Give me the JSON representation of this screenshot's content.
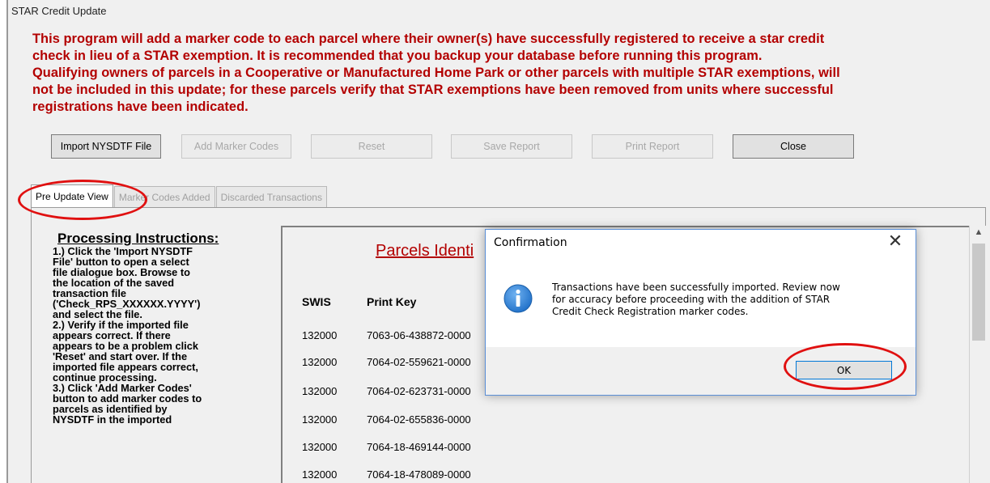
{
  "window": {
    "title": "STAR Credit Update"
  },
  "intro_lines": [
    "This program will add a marker code to each parcel where their owner(s) have successfully registered to receive a star credit",
    "check in lieu of a STAR exemption.  It is recommended that you backup your database before running this program.",
    "Qualifying owners of parcels in a Cooperative or Manufactured Home Park or other parcels with multiple STAR exemptions, will",
    "not be included in this update; for these parcels verify that STAR exemptions have been removed from units where successful",
    "registrations have been indicated."
  ],
  "toolbar": {
    "import_label": "Import NYSDTF File",
    "add_marker_label": "Add Marker Codes",
    "reset_label": "Reset",
    "save_report_label": "Save Report",
    "print_report_label": "Print Report",
    "close_label": "Close"
  },
  "tabs": [
    {
      "label": "Pre Update View",
      "active": true
    },
    {
      "label": "Marker Codes Added",
      "active": false
    },
    {
      "label": "Discarded Transactions",
      "active": false
    }
  ],
  "instructions": {
    "title": "Processing Instructions:",
    "lines": [
      "1.) Click the 'Import NYSDTF",
      "File' button to open a select",
      "file dialogue box.  Browse to",
      "the location of the saved",
      "transaction file",
      "('Check_RPS_XXXXXX.YYYY')",
      "and select the file.",
      "2.) Verify if the imported file",
      "appears correct.  If there",
      "appears to be a problem click",
      "'Reset' and start over.  If the",
      "imported file appears correct,",
      "continue processing.",
      "3.) Click 'Add Marker Codes'",
      "button to add marker codes to",
      "parcels as identified by",
      "NYSDTF in the imported"
    ]
  },
  "grid": {
    "title": "Parcels Identi",
    "columns": [
      "SWIS",
      "Print Key"
    ],
    "rows": [
      {
        "swis": "132000",
        "print_key": "7063-06-438872-0000"
      },
      {
        "swis": "132000",
        "print_key": "7064-02-559621-0000"
      },
      {
        "swis": "132000",
        "print_key": "7064-02-623731-0000"
      },
      {
        "swis": "132000",
        "print_key": "7064-02-655836-0000"
      },
      {
        "swis": "132000",
        "print_key": "7064-18-469144-0000"
      },
      {
        "swis": "132000",
        "print_key": "7064-18-478089-0000"
      }
    ]
  },
  "dialog": {
    "title": "Confirmation",
    "close_glyph": "✕",
    "icon": "information-icon",
    "message_lines": [
      "Transactions have been successfully imported.  Review now",
      "for accuracy before proceeding with the addition of STAR",
      "Credit Check Registration marker codes."
    ],
    "ok_label": "OK"
  },
  "colors": {
    "intro_text": "#b30000",
    "annotation": "#e01010",
    "info_icon": "#1e6fc8"
  }
}
